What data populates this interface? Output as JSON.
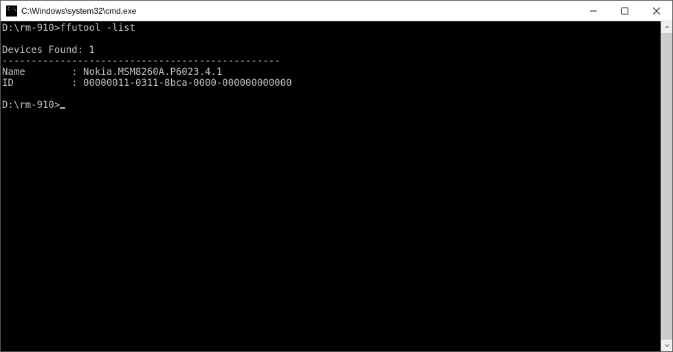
{
  "window": {
    "title": "C:\\Windows\\system32\\cmd.exe"
  },
  "terminal": {
    "line1_prompt": "D:\\rm-910>",
    "line1_command": "ffutool -list",
    "blank1": "",
    "devices_found": "Devices Found: 1",
    "separator": "------------------------------------------------",
    "name_label": "Name",
    "name_sep": "        : ",
    "name_value": "Nokia.MSM8260A.P6023.4.1",
    "id_label": "ID",
    "id_sep": "          : ",
    "id_value": "00000011-0311-8bca-0000-000000000000",
    "blank2": "",
    "line2_prompt": "D:\\rm-910>"
  }
}
